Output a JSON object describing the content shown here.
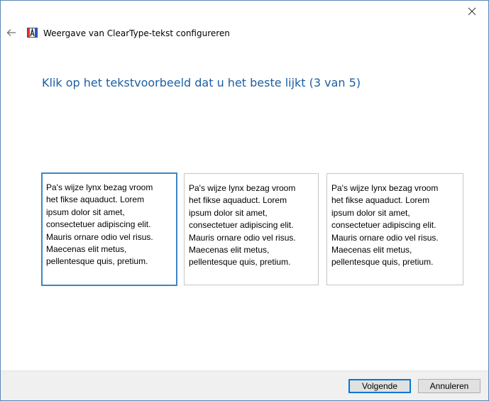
{
  "window": {
    "title": "Weergave van ClearType-tekst configureren",
    "accent_color": "#1c5ea1",
    "selected_border_color": "#3d86c4"
  },
  "header": {
    "back_icon": "arrow-left-icon",
    "app_icon": "cleartype-icon",
    "close_icon": "close-icon"
  },
  "main": {
    "instruction": "Klik op het tekstvoorbeeld dat u het beste lijkt (3 van 5)",
    "samples": [
      {
        "lines": [
          "Pa's wijze lynx bezag vroom",
          "het fikse aquaduct. Lorem",
          "ipsum dolor sit amet,",
          "consectetuer adipiscing elit.",
          "Mauris ornare odio vel risus.",
          "Maecenas elit metus,",
          "pellentesque quis, pretium."
        ],
        "selected": true
      },
      {
        "lines": [
          "Pa's wijze lynx bezag vroom",
          "het fikse aquaduct. Lorem",
          "ipsum dolor sit amet,",
          "consectetuer adipiscing elit.",
          "Mauris ornare odio vel risus.",
          "Maecenas elit metus,",
          "pellentesque quis, pretium."
        ],
        "selected": false
      },
      {
        "lines": [
          "Pa's wijze lynx bezag vroom",
          "het fikse aquaduct. Lorem",
          "ipsum dolor sit amet,",
          "consectetuer adipiscing elit.",
          "Mauris ornare odio vel risus.",
          "Maecenas elit metus,",
          "pellentesque quis, pretium."
        ],
        "selected": false
      }
    ]
  },
  "footer": {
    "next_label": "Volgende",
    "cancel_label": "Annuleren"
  }
}
